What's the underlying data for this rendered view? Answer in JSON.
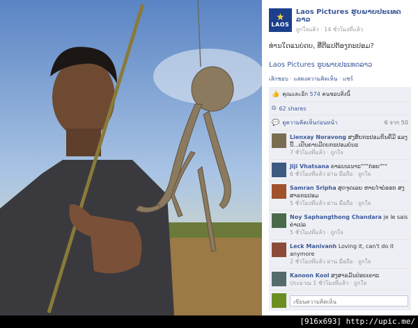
{
  "page": {
    "name": "Laos Pictures ຮູບພາບປະເທດລາວ",
    "meta": "ถูกใจแล้ว · 14 ชั่วโมงที่แล้ว",
    "logo_text": "LAOS"
  },
  "post": {
    "caption": "ທ່ານໃດແນບ່ດບ, ທີ່ຕີແປຕ້ອງກະປອມ?",
    "page_link": "Laos Pictures ຮູບພາບປະເທດລາວ",
    "actions": [
      "เลิกชอบ",
      "แสดงความคิดเห็น",
      "แชร์"
    ]
  },
  "stats": {
    "likes_prefix": "คุณและอีก",
    "likes_count": "574",
    "likes_suffix": "คนชอบสิ่งนี้",
    "shares": "62 shares",
    "more_comments": "ดูความคิดเห็นก่อนหน้า",
    "comment_range": "6 จาก 50"
  },
  "comments": [
    {
      "name": "Lienxay Noravong",
      "text": "ສງສັຍກະປອມກິນຄືມີ ແລງນີ້...ເປັນຄາບມີດບກະປອມບໍ່ນະ",
      "meta": "7 ชั่วโมงที่แล้ว · ถูกใจ",
      "color": "#7b6d52"
    },
    {
      "name": "Jiji Vhatsana",
      "text": "ຄາແບນເນາະ\"\"\"ກ່ອຍ\"\"\"",
      "meta": "6 ชั่วโมงที่แล้ว ผ่าน มือถือ · ถูกใจ",
      "color": "#3d5a80"
    },
    {
      "name": "Samran Sripha",
      "text": "ສຸດຈຸດເລຍ ຫາຍໄຈບໍ່ອອກ ສງສາຣກະປອມ",
      "meta": "5 ชั่วโมงที่แล้ว ผ่าน มือถือ · ถูกใจ",
      "color": "#a0522d"
    },
    {
      "name": "Noy Saphangthong Chandara",
      "text": "je le sais ຄ່າເປລ",
      "meta": "5 ชั่วโมงที่แล้ว · ถูกใจ",
      "color": "#4a6b4a"
    },
    {
      "name": "Leck Manivanh",
      "text": "Loving it, can't do it anymore",
      "meta": "2 ชั่วโมงที่แล้ว ผ่าน มือถือ · ถูกใจ",
      "color": "#8c4b3a"
    },
    {
      "name": "Kanoon Kool",
      "text": "ສງສາຣມັນປ່ອຍເຄາະ",
      "meta": "ประมาณ 1 ชั่วโมงที่แล้ว · ถูกใจ",
      "color": "#556b6b"
    }
  ],
  "composer": {
    "placeholder": "เขียนความคิดเห็น"
  },
  "footer": {
    "text": "[916x693] http://upic.me/"
  }
}
